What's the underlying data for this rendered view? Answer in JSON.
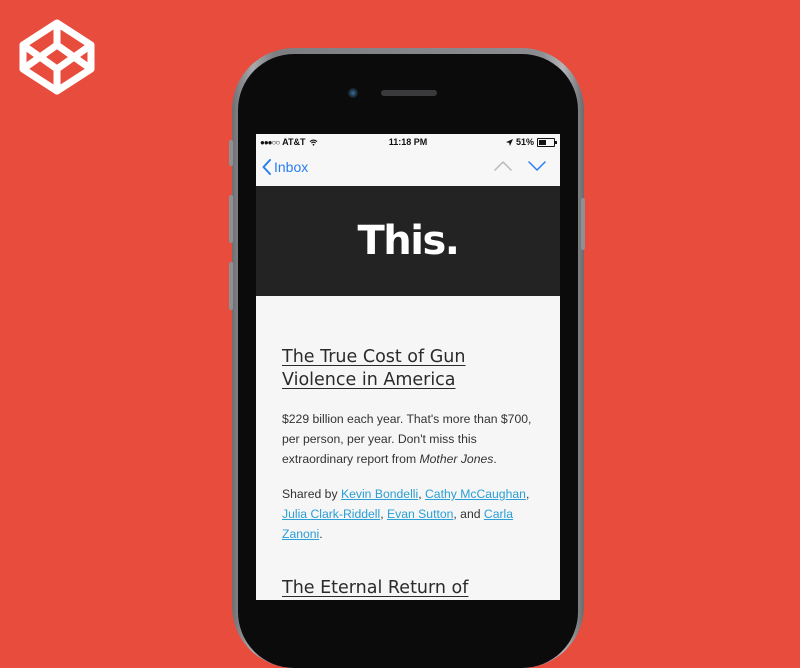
{
  "brand": {
    "logo_icon": "codepen-logo-icon",
    "background": "#e74c3c"
  },
  "status_bar": {
    "carrier": "AT&T",
    "time": "11:18 PM",
    "battery": "51%",
    "battery_level": 0.51
  },
  "nav": {
    "back_label": "Inbox",
    "accent": "#2a7ef0"
  },
  "email": {
    "header_title": "This.",
    "article_1": {
      "title": "The True Cost of Gun Violence in America",
      "body": "$229 billion each year. That's more than $700, per person, per year. Don't miss this extraordinary report from ",
      "publication": "Mother Jones",
      "body_end": ".",
      "shared_prefix": "Shared by ",
      "sharers": [
        "Kevin Bondelli",
        "Cathy McCaughan",
        "Julia Clark-Riddell",
        "Evan Sutton",
        "Carla Zanoni"
      ],
      "sep_comma": ", ",
      "sep_and": ", and ",
      "shared_end": "."
    },
    "article_2": {
      "title": "The Eternal Return of"
    }
  }
}
